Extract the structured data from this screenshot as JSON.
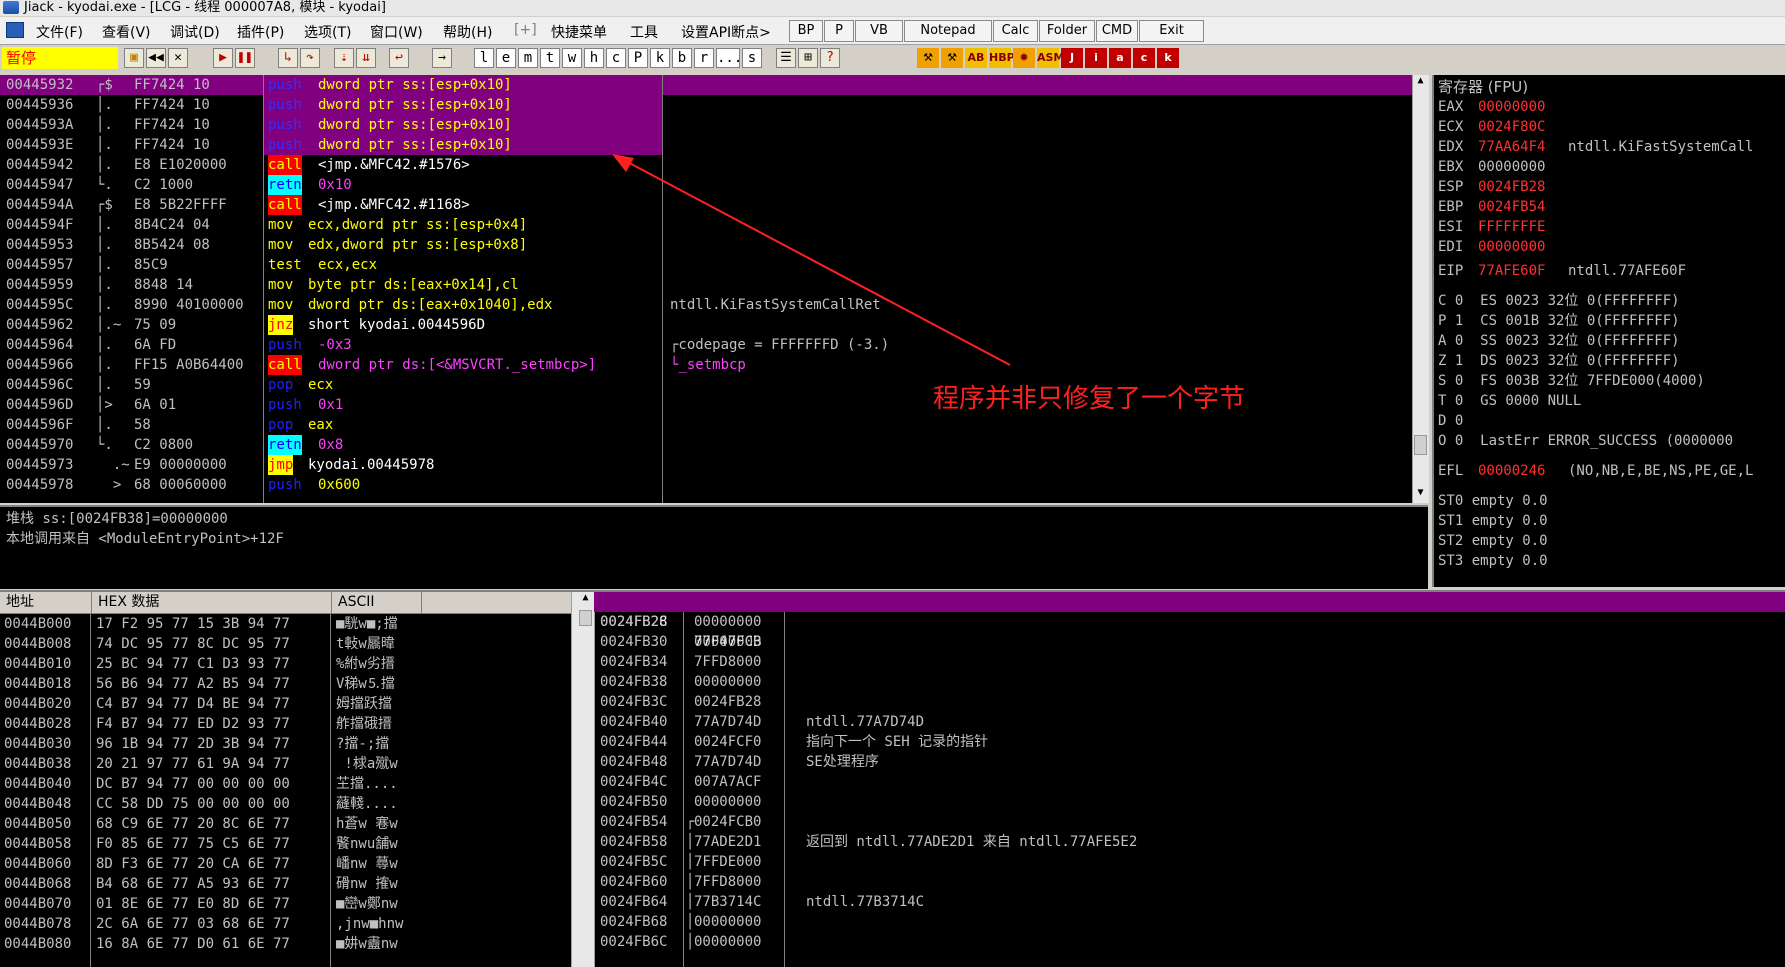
{
  "window": {
    "title": "Jiack - kyodai.exe - [LCG - 线程 000007A8, 模块 - kyodai]"
  },
  "menu": {
    "items": [
      "文件(F)",
      "查看(V)",
      "调试(D)",
      "插件(P)",
      "选项(T)",
      "窗口(W)",
      "帮助(H)",
      "[+]",
      "快捷菜单",
      "工具",
      "设置API断点>"
    ],
    "quick": [
      "BP",
      "P",
      "VB",
      "Notepad",
      "Calc",
      "Folder",
      "CMD",
      "Exit"
    ]
  },
  "toolbar": {
    "status": "暂停",
    "letters": [
      "l",
      "e",
      "m",
      "t",
      "w",
      "h",
      "c",
      "P",
      "k",
      "b",
      "r",
      "...",
      "s"
    ],
    "plugins": [
      "J",
      "i",
      "a",
      "c",
      "k"
    ]
  },
  "disasm": {
    "rows": [
      {
        "addr": "00445932",
        "mark": "┌$",
        "hex": "FF7424 10",
        "mnem": "push",
        "ops": "dword ptr ss:[esp+0x10]",
        "comment": ""
      },
      {
        "addr": "00445936",
        "mark": "│.",
        "hex": "FF7424 10",
        "mnem": "push",
        "ops": "dword ptr ss:[esp+0x10]",
        "comment": ""
      },
      {
        "addr": "0044593A",
        "mark": "│.",
        "hex": "FF7424 10",
        "mnem": "push",
        "ops": "dword ptr ss:[esp+0x10]",
        "comment": ""
      },
      {
        "addr": "0044593E",
        "mark": "│.",
        "hex": "FF7424 10",
        "mnem": "push",
        "ops": "dword ptr ss:[esp+0x10]",
        "comment": ""
      },
      {
        "addr": "00445942",
        "mark": "│.",
        "hex": "E8 E1020000",
        "mnem": "call",
        "ops": "<jmp.&MFC42.#1576>",
        "comment": ""
      },
      {
        "addr": "00445947",
        "mark": "└.",
        "hex": "C2 1000",
        "mnem": "retn",
        "ops": "0x10",
        "comment": ""
      },
      {
        "addr": "0044594A",
        "mark": "┌$",
        "hex": "E8 5B22FFFF",
        "mnem": "call",
        "ops": "<jmp.&MFC42.#1168>",
        "comment": ""
      },
      {
        "addr": "0044594F",
        "mark": "│.",
        "hex": "8B4C24 04",
        "mnem": "mov",
        "ops": "ecx,dword ptr ss:[esp+0x4]",
        "comment": ""
      },
      {
        "addr": "00445953",
        "mark": "│.",
        "hex": "8B5424 08",
        "mnem": "mov",
        "ops": "edx,dword ptr ss:[esp+0x8]",
        "comment": ""
      },
      {
        "addr": "00445957",
        "mark": "│.",
        "hex": "85C9",
        "mnem": "test",
        "ops": "ecx,ecx",
        "comment": ""
      },
      {
        "addr": "00445959",
        "mark": "│.",
        "hex": "8848 14",
        "mnem": "mov",
        "ops": "byte ptr ds:[eax+0x14],cl",
        "comment": ""
      },
      {
        "addr": "0044595C",
        "mark": "│.",
        "hex": "8990 40100000",
        "mnem": "mov",
        "ops": "dword ptr ds:[eax+0x1040],edx",
        "comment": "ntdll.KiFastSystemCallRet"
      },
      {
        "addr": "00445962",
        "mark": "│.~",
        "hex": "75 09",
        "mnem": "jnz",
        "ops": "short kyodai.0044596D",
        "comment": ""
      },
      {
        "addr": "00445964",
        "mark": "│.",
        "hex": "6A FD",
        "mnem": "push",
        "ops": "-0x3",
        "comment": "┌codepage = FFFFFFFD (-3.)"
      },
      {
        "addr": "00445966",
        "mark": "│.",
        "hex": "FF15 A0B64400",
        "mnem": "call",
        "ops": "dword ptr ds:[<&MSVCRT._setmbcp>]",
        "comment": "└_setmbcp"
      },
      {
        "addr": "0044596C",
        "mark": "│.",
        "hex": "59",
        "mnem": "pop",
        "ops": "ecx",
        "comment": ""
      },
      {
        "addr": "0044596D",
        "mark": "│>",
        "hex": "6A 01",
        "mnem": "push",
        "ops": "0x1",
        "comment": ""
      },
      {
        "addr": "0044596F",
        "mark": "│.",
        "hex": "58",
        "mnem": "pop",
        "ops": "eax",
        "comment": ""
      },
      {
        "addr": "00445970",
        "mark": "└.",
        "hex": "C2 0800",
        "mnem": "retn",
        "ops": "0x8",
        "comment": ""
      },
      {
        "addr": "00445973",
        "mark": "  .~",
        "hex": "E9 00000000",
        "mnem": "jmp",
        "ops": "kyodai.00445978",
        "comment": ""
      },
      {
        "addr": "00445978",
        "mark": "  >",
        "hex": "68 00060000",
        "mnem": "push",
        "ops": "0x600",
        "comment": ""
      }
    ],
    "annotation": "程序并非只修复了一个字节"
  },
  "info": {
    "line1": "堆栈 ss:[0024FB38]=00000000",
    "line2": "本地调用来自 <ModuleEntryPoint>+12F"
  },
  "registers": {
    "title": "寄存器 (FPU)",
    "regs": [
      {
        "name": "EAX",
        "val": "00000000",
        "extra": ""
      },
      {
        "name": "ECX",
        "val": "0024F80C",
        "extra": ""
      },
      {
        "name": "EDX",
        "val": "77AA64F4",
        "extra": "ntdll.KiFastSystemCall"
      },
      {
        "name": "EBX",
        "val": "00000000",
        "extra": ""
      },
      {
        "name": "ESP",
        "val": "0024FB28",
        "extra": ""
      },
      {
        "name": "EBP",
        "val": "0024FB54",
        "extra": ""
      },
      {
        "name": "ESI",
        "val": "FFFFFFFE",
        "extra": ""
      },
      {
        "name": "EDI",
        "val": "00000000",
        "extra": ""
      }
    ],
    "eip": {
      "name": "EIP",
      "val": "77AFE60F",
      "extra": "ntdll.77AFE60F"
    },
    "flags": [
      "C 0  ES 0023 32位 0(FFFFFFFF)",
      "P 1  CS 001B 32位 0(FFFFFFFF)",
      "A 0  SS 0023 32位 0(FFFFFFFF)",
      "Z 1  DS 0023 32位 0(FFFFFFFF)",
      "S 0  FS 003B 32位 7FFDE000(4000)",
      "T 0  GS 0000 NULL",
      "D 0",
      "O 0  LastErr ERROR_SUCCESS (0000000"
    ],
    "efl": {
      "name": "EFL",
      "val": "00000246",
      "extra": "(NO,NB,E,BE,NS,PE,GE,L"
    },
    "fpu": [
      "ST0 empty 0.0",
      "ST1 empty 0.0",
      "ST2 empty 0.0",
      "ST3 empty 0.0"
    ]
  },
  "dump": {
    "headers": [
      "地址",
      "HEX 数据",
      "ASCII"
    ],
    "rows": [
      {
        "addr": "0044B000",
        "hex": "17 F2 95 77 15 3B 94 77",
        "ascii": "■駫w■;擋"
      },
      {
        "addr": "0044B008",
        "hex": "74 DC 95 77 8C DC 95 77",
        "ascii": "t軙w屫暐"
      },
      {
        "addr": "0044B010",
        "hex": "25 BC 94 77 C1 D3 93 77",
        "ascii": "%紨w劣搢"
      },
      {
        "addr": "0044B018",
        "hex": "56 B6 94 77 A2 B5 94 77",
        "ascii": "V稊w⒌擋"
      },
      {
        "addr": "0044B020",
        "hex": "C4 B7 94 77 D4 BE 94 77",
        "ascii": "姆擋跃擋"
      },
      {
        "addr": "0044B028",
        "hex": "F4 B7 94 77 ED D2 93 77",
        "ascii": "舴擋硪搢"
      },
      {
        "addr": "0044B030",
        "hex": "96 1B 94 77 2D 3B 94 77",
        "ascii": "?擋-;擋"
      },
      {
        "addr": "0044B038",
        "hex": "20 21 97 77 61 9A 94 77",
        " ascii": "",
        "ascii": " !梂a殧w"
      },
      {
        "addr": "0044B040",
        "hex": "DC B7 94 77 00 00 00 00",
        "ascii": "芏擋...."
      },
      {
        "addr": "0044B048",
        "hex": "CC 58 DD 75 00 00 00 00",
        "ascii": "蘕輚...."
      },
      {
        "addr": "0044B050",
        "hex": "68 C9 6E 77 20 8C 6E 77",
        "ascii": "h蒼w 寋w"
      },
      {
        "addr": "0044B058",
        "hex": "F0 85 6E 77 75 C5 6E 77",
        "ascii": "饏nwu舗w"
      },
      {
        "addr": "0044B060",
        "hex": "8D F3 6E 77 20 CA 6E 77",
        "ascii": "嶓nw 蕁w"
      },
      {
        "addr": "0044B068",
        "hex": "B4 68 6E 77 A5 93 6E 77",
        "ascii": "磆nw 搉w"
      },
      {
        "addr": "0044B070",
        "hex": "01 8E 6E 77 E0 8D 6E 77",
        "ascii": "■巒w鄭nw"
      },
      {
        "addr": "0044B078",
        "hex": "2C 6A 6E 77 03 68 6E 77",
        "ascii": ",jnw■hnw"
      },
      {
        "addr": "0044B080",
        "hex": "16 8A 6E 77 D0 61 6E 77",
        "ascii": "■妌w衋nw"
      }
    ]
  },
  "stack": {
    "top": {
      "addr": "0024FB28",
      "val": "77F47FCB"
    },
    "rows": [
      {
        "addr": "0024FB2C",
        "mark": " ",
        "val": "00000000",
        "comment": ""
      },
      {
        "addr": "0024FB30",
        "mark": " ",
        "val": "00000000",
        "comment": ""
      },
      {
        "addr": "0024FB34",
        "mark": " ",
        "val": "7FFD8000",
        "comment": ""
      },
      {
        "addr": "0024FB38",
        "mark": " ",
        "val": "00000000",
        "comment": ""
      },
      {
        "addr": "0024FB3C",
        "mark": " ",
        "val": "0024FB28",
        "comment": ""
      },
      {
        "addr": "0024FB40",
        "mark": " ",
        "val": "77A7D74D",
        "comment": "ntdll.77A7D74D"
      },
      {
        "addr": "0024FB44",
        "mark": " ",
        "val": "0024FCF0",
        "comment": "指向下一个 SEH 记录的指针"
      },
      {
        "addr": "0024FB48",
        "mark": " ",
        "val": "77A7D74D",
        "comment": "SE处理程序"
      },
      {
        "addr": "0024FB4C",
        "mark": " ",
        "val": "007A7ACF",
        "comment": ""
      },
      {
        "addr": "0024FB50",
        "mark": " ",
        "val": "00000000",
        "comment": ""
      },
      {
        "addr": "0024FB54",
        "mark": "┌",
        "val": "0024FCB0",
        "comment": ""
      },
      {
        "addr": "0024FB58",
        "mark": "│",
        "val": "77ADE2D1",
        "comment": "返回到 ntdll.77ADE2D1 来自 ntdll.77AFE5E2"
      },
      {
        "addr": "0024FB5C",
        "mark": "│",
        "val": "7FFDE000",
        "comment": ""
      },
      {
        "addr": "0024FB60",
        "mark": "│",
        "val": "7FFD8000",
        "comment": ""
      },
      {
        "addr": "0024FB64",
        "mark": "│",
        "val": "77B3714C",
        "comment": "ntdll.77B3714C"
      },
      {
        "addr": "0024FB68",
        "mark": "│",
        "val": "00000000",
        "comment": ""
      },
      {
        "addr": "0024FB6C",
        "mark": "│",
        "val": "00000000",
        "comment": ""
      }
    ]
  },
  "colors": {
    "selection": "#800080",
    "annotation": "#ff2020"
  }
}
